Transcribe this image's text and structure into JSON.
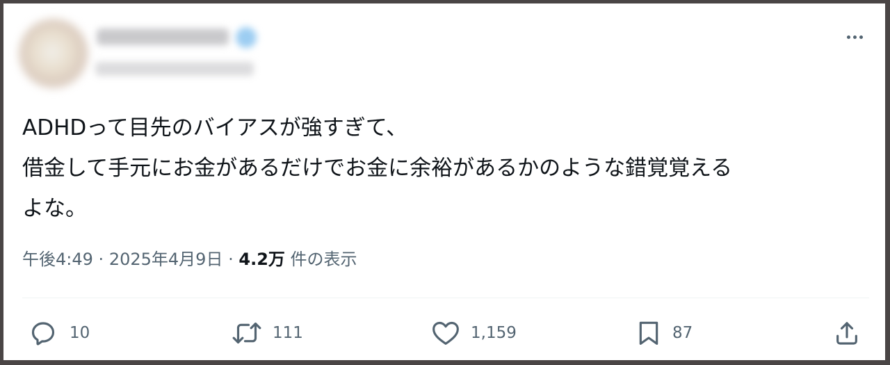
{
  "tweet": {
    "text_lines": [
      "ADHDって目先のバイアスが強すぎて、",
      "借金して手元にお金があるだけでお金に余裕があるかのような錯覚覚える",
      "よな。"
    ],
    "time": "午後4:49",
    "date": "2025年4月9日",
    "separator": "·",
    "views": "4.2万",
    "views_label": "件の表示"
  },
  "actions": {
    "reply_count": "10",
    "retweet_count": "111",
    "like_count": "1,159",
    "bookmark_count": "87"
  },
  "icons": {
    "more": "more-horizontal-icon",
    "reply": "reply-icon",
    "retweet": "retweet-icon",
    "like": "heart-icon",
    "bookmark": "bookmark-icon",
    "share": "share-icon"
  },
  "colors": {
    "text": "#0f1419",
    "secondary": "#536471",
    "background": "#ffffff"
  }
}
